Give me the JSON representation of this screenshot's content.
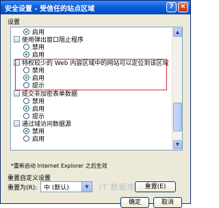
{
  "window": {
    "title": "安全设置 - 受信任的站点区域",
    "help_glyph": "?",
    "close_glyph": "×"
  },
  "settings": {
    "label": "设置",
    "items": [
      {
        "kind": "option",
        "label": "启用",
        "selected": true
      },
      {
        "kind": "category",
        "label": "使用弹出窗口阻止程序",
        "icon": "settings-group-icon"
      },
      {
        "kind": "option",
        "label": "禁用",
        "selected": false
      },
      {
        "kind": "option",
        "label": "启用",
        "selected": true
      },
      {
        "kind": "category",
        "label": "特权较少的 Web 内容区域中的网站可以定位到该区域",
        "icon": "settings-group-icon"
      },
      {
        "kind": "option",
        "label": "禁用",
        "selected": false
      },
      {
        "kind": "option",
        "label": "启用",
        "selected": true
      },
      {
        "kind": "option",
        "label": "提示",
        "selected": false
      },
      {
        "kind": "category",
        "label": "提交非加密表单数据",
        "icon": "settings-group-icon"
      },
      {
        "kind": "option",
        "label": "禁用",
        "selected": false
      },
      {
        "kind": "option",
        "label": "启用",
        "selected": true
      },
      {
        "kind": "option",
        "label": "提示",
        "selected": false
      },
      {
        "kind": "category",
        "label": "通过域访问数据源",
        "icon": "settings-group-icon"
      },
      {
        "kind": "option",
        "label": "禁用",
        "selected": true
      },
      {
        "kind": "option",
        "label": "启用",
        "selected": false
      }
    ],
    "scroll_up": "▲",
    "scroll_down": "▼"
  },
  "restart_note": "*重新启动 Internet Explorer 之后生效",
  "reset": {
    "group_label": "重置自定义设置",
    "reset_to_label": "重置为(R):",
    "selected_value": "中 (默认)",
    "dropdown_arrow": "▼",
    "reset_button": "重置(E)"
  },
  "watermark": "IT 数据库...",
  "buttons": {
    "ok": "确定",
    "cancel": "取消"
  },
  "colors": {
    "titlebar": "#0a5fd8",
    "highlight_box": "#cc2a2a",
    "dialog_bg": "#ece9d8"
  }
}
